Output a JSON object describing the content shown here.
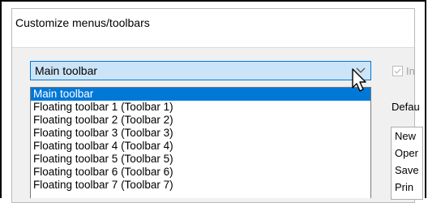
{
  "dialog": {
    "title": "Customize menus/toolbars"
  },
  "toolbar_select": {
    "value": "Main toolbar",
    "options": [
      "Main toolbar",
      "Floating toolbar 1 (Toolbar 1)",
      "Floating toolbar 2 (Toolbar 2)",
      "Floating toolbar 3 (Toolbar 3)",
      "Floating toolbar 4 (Toolbar 4)",
      "Floating toolbar 5 (Toolbar 5)",
      "Floating toolbar 6 (Toolbar 6)",
      "Floating toolbar 7 (Toolbar 7)"
    ],
    "selected_index": 0
  },
  "right_panel": {
    "checkbox_label": "In",
    "default_label": "Defau",
    "commands": [
      "New",
      "Oper",
      "Save",
      "Prin"
    ]
  },
  "colors": {
    "highlight": "#0078d7",
    "combo_bg": "#cce4f7"
  }
}
